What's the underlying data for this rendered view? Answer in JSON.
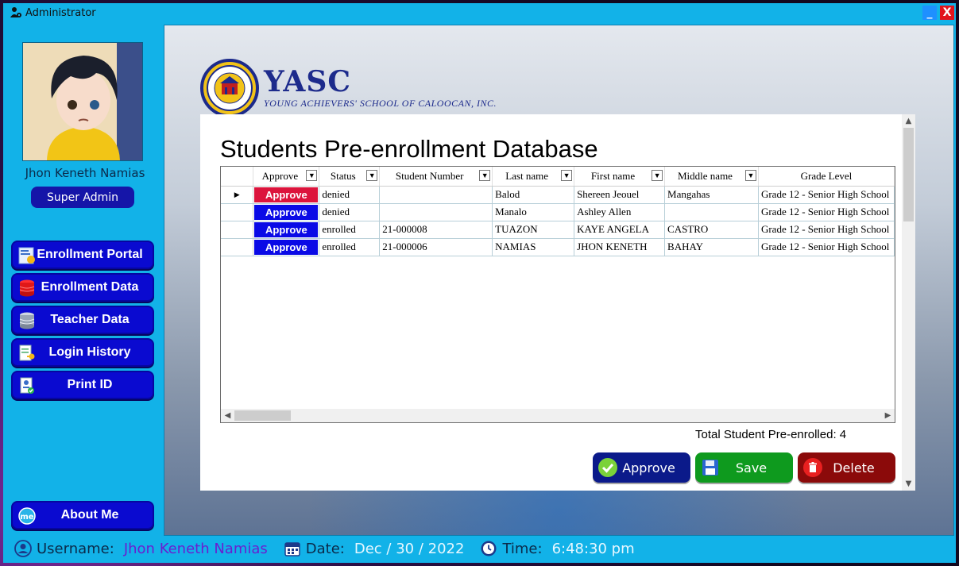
{
  "window": {
    "title": "Administrator",
    "minimize_symbol": "_",
    "close_symbol": "X"
  },
  "sidebar": {
    "user_name": "Jhon Keneth Namias",
    "role": "Super Admin",
    "nav": [
      {
        "label": "Enrollment Portal",
        "icon": "portal-icon"
      },
      {
        "label": "Enrollment Data",
        "icon": "database-red-icon"
      },
      {
        "label": "Teacher Data",
        "icon": "database-gray-icon"
      },
      {
        "label": "Login History",
        "icon": "history-icon"
      },
      {
        "label": "Print ID",
        "icon": "id-card-icon"
      }
    ],
    "about": {
      "label": "About Me",
      "icon": "me-icon",
      "icon_text": "me"
    }
  },
  "logo": {
    "name": "YASC",
    "subtitle": "YOUNG ACHIEVERS' SCHOOL OF CALOOCAN, INC."
  },
  "main": {
    "title": "Students Pre-enrollment Database",
    "grid": {
      "columns": [
        "Approve",
        "Status",
        "Student Number",
        "Last name",
        "First name",
        "Middle name",
        "Grade Level"
      ],
      "rows": [
        {
          "approve": "Approve",
          "approve_color": "#dc143c",
          "status": "denied",
          "student_number": "",
          "last_name": "Balod",
          "first_name": "Shereen Jeouel",
          "middle_name": "Mangahas",
          "grade_level": "Grade 12 - Senior High School"
        },
        {
          "approve": "Approve",
          "approve_color": "#0a0ae6",
          "status": "denied",
          "student_number": "",
          "last_name": "Manalo",
          "first_name": "Ashley Allen",
          "middle_name": "",
          "grade_level": "Grade 12 - Senior High School"
        },
        {
          "approve": "Approve",
          "approve_color": "#0a0ae6",
          "status": "enrolled",
          "student_number": "21-000008",
          "last_name": "TUAZON",
          "first_name": "KAYE ANGELA",
          "middle_name": "CASTRO",
          "grade_level": "Grade 12 - Senior High School"
        },
        {
          "approve": "Approve",
          "approve_color": "#0a0ae6",
          "status": "enrolled",
          "student_number": "21-000006",
          "last_name": "NAMIAS",
          "first_name": "JHON KENETH",
          "middle_name": "BAHAY",
          "grade_level": "Grade 12 - Senior High School"
        }
      ]
    },
    "total_label": "Total Student Pre-enrolled: 4",
    "actions": {
      "approve": {
        "label": "Approve",
        "color": "#0b1a8a",
        "icon": "check-icon"
      },
      "save": {
        "label": "Save",
        "color": "#0e9a1e",
        "icon": "floppy-icon"
      },
      "delete": {
        "label": "Delete",
        "color": "#8b0a0a",
        "icon": "trash-icon"
      }
    }
  },
  "statusbar": {
    "username_key": "Username:",
    "username": "Jhon Keneth Namias",
    "date_key": "Date:",
    "date": "Dec / 30 / 2022",
    "time_key": "Time:",
    "time": "6:48:30 pm"
  }
}
